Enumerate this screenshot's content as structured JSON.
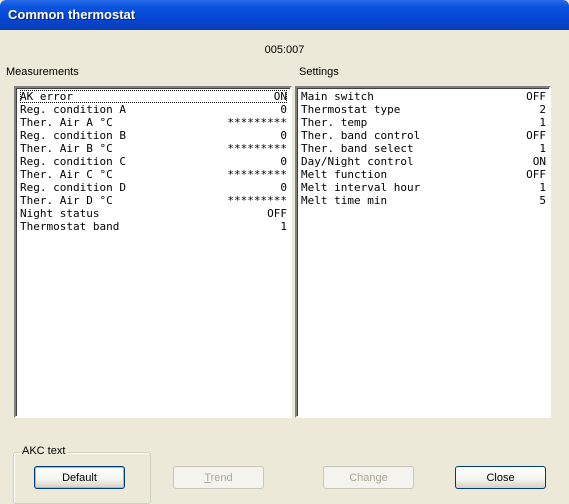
{
  "window": {
    "title": "Common thermostat"
  },
  "device_id": "005:007",
  "measurements": {
    "label": "Measurements",
    "rows": [
      {
        "name": "AK error",
        "value": "ON"
      },
      {
        "name": "Reg. condition A",
        "value": "0"
      },
      {
        "name": "Ther. Air A °C",
        "value": "*********"
      },
      {
        "name": "Reg. condition B",
        "value": "0"
      },
      {
        "name": "Ther. Air B °C",
        "value": "*********"
      },
      {
        "name": "Reg. condition C",
        "value": "0"
      },
      {
        "name": "Ther. Air C °C",
        "value": "*********"
      },
      {
        "name": "Reg. condition D",
        "value": "0"
      },
      {
        "name": "Ther. Air D °C",
        "value": "*********"
      },
      {
        "name": "Night status",
        "value": "OFF"
      },
      {
        "name": "Thermostat band",
        "value": "1"
      }
    ]
  },
  "settings": {
    "label": "Settings",
    "rows": [
      {
        "name": "Main switch",
        "value": "OFF"
      },
      {
        "name": "Thermostat type",
        "value": "2"
      },
      {
        "name": "Ther. temp",
        "value": "1"
      },
      {
        "name": "Ther. band control",
        "value": "OFF"
      },
      {
        "name": "Ther. band select",
        "value": "1"
      },
      {
        "name": "Day/Night control",
        "value": "ON"
      },
      {
        "name": "Melt function",
        "value": "OFF"
      },
      {
        "name": "Melt interval hour",
        "value": "1"
      },
      {
        "name": "Melt time min",
        "value": "5"
      }
    ]
  },
  "akc_text": {
    "label": "AKC text",
    "default_button": "Default"
  },
  "buttons": {
    "trend": "Trend",
    "change": "Change",
    "close": "Close"
  }
}
